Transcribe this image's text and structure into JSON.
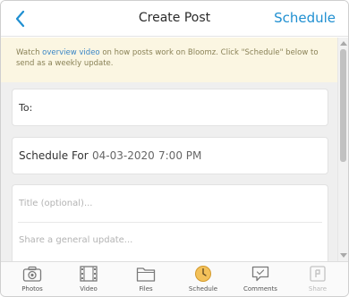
{
  "header": {
    "title": "Create Post",
    "action_label": "Schedule"
  },
  "notice": {
    "prefix": "Watch ",
    "link": "overview video",
    "suffix": " on how posts work on Bloomz. Click \"Schedule\" below to send as a weekly update."
  },
  "recipient": {
    "label": "To:"
  },
  "schedule": {
    "label": "Schedule For",
    "date": "04-03-2020",
    "time": "7:00 PM"
  },
  "compose": {
    "title_placeholder": "Title (optional)...",
    "body_placeholder": "Share a general update..."
  },
  "toolbar": {
    "items": [
      {
        "label": "Photos",
        "icon": "camera-icon"
      },
      {
        "label": "Video",
        "icon": "film-icon"
      },
      {
        "label": "Files",
        "icon": "folder-icon"
      },
      {
        "label": "Schedule",
        "icon": "clock-icon"
      },
      {
        "label": "Comments",
        "icon": "comment-icon"
      },
      {
        "label": "Share",
        "icon": "share-icon"
      }
    ]
  },
  "colors": {
    "accent": "#1f8fd1",
    "notice_bg": "#fbf6e2",
    "schedule_icon": "#f3c15a"
  }
}
